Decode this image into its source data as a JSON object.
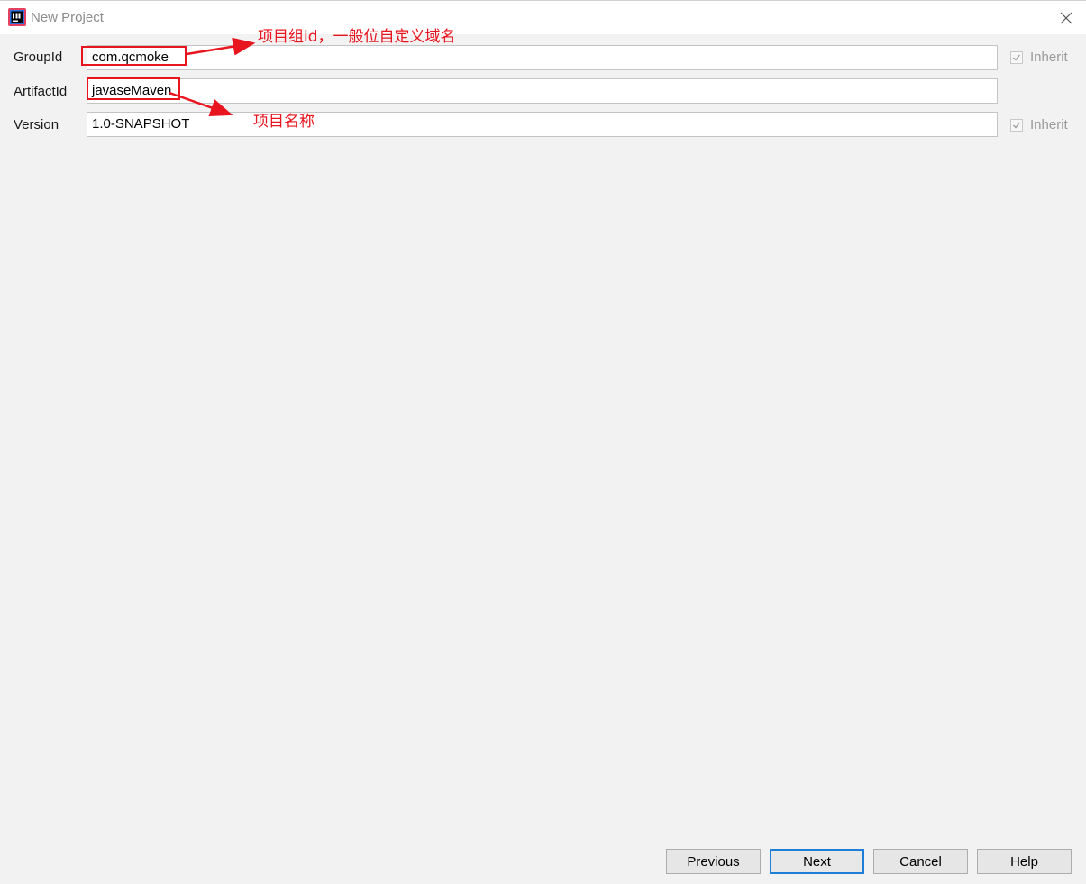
{
  "window": {
    "title": "New Project"
  },
  "form": {
    "group_id": {
      "label": "GroupId",
      "value": "com.qcmoke",
      "inherit_label": "Inherit",
      "inherit_checked": true
    },
    "artifact_id": {
      "label": "ArtifactId",
      "value": "javaseMaven"
    },
    "version": {
      "label": "Version",
      "value": "1.0-SNAPSHOT",
      "inherit_label": "Inherit",
      "inherit_checked": true
    }
  },
  "annotations": {
    "group_note": "项目组id，一般位自定义域名",
    "artifact_note": "项目名称",
    "color": "#e8141e"
  },
  "buttons": {
    "previous": "Previous",
    "next": "Next",
    "cancel": "Cancel",
    "help": "Help"
  },
  "colors": {
    "accent": "#1f7fd6",
    "background": "#f2f2f2"
  }
}
